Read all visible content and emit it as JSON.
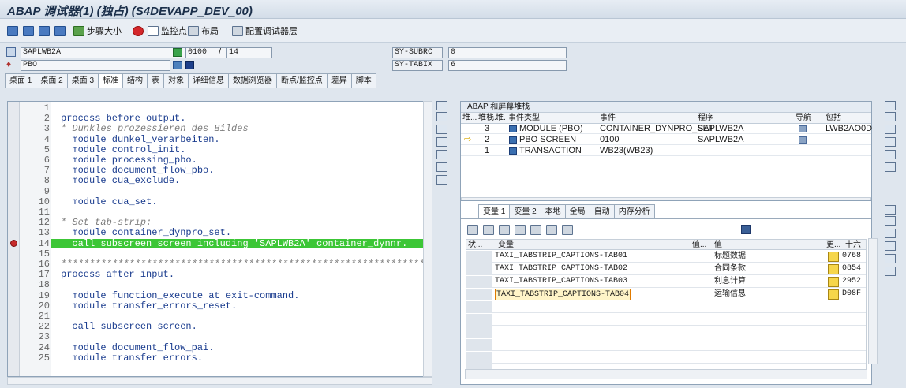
{
  "window": {
    "title": "ABAP 调试器(1)  (独占) (S4DEVAPP_DEV_00)"
  },
  "toolbar": {
    "step_size": "步骤大小",
    "watchpoint": "监控点",
    "layout": "布局",
    "configure": "配置调试器层"
  },
  "info": {
    "program": "SAPLWB2A",
    "screen_prog": "PBO",
    "dynpro": "0100",
    "dynpro_count": "14",
    "subrc_label": "SY-SUBRC",
    "subrc_value": "0",
    "tabix_label": "SY-TABIX",
    "tabix_value": "6"
  },
  "tabs": [
    "桌面 1",
    "桌面 2",
    "桌面 3",
    "标准",
    "结构",
    "表",
    "对象",
    "详细信息",
    "数据浏览器",
    "断点/监控点",
    "差异",
    "脚本"
  ],
  "active_tab": "标准",
  "code": {
    "lines": [
      {
        "n": "1",
        "t": ""
      },
      {
        "n": "2",
        "t": "process before output."
      },
      {
        "n": "3",
        "t": "* Dunkles prozessieren des Bildes"
      },
      {
        "n": "4",
        "t": "  module dunkel_verarbeiten."
      },
      {
        "n": "5",
        "t": "  module control_init."
      },
      {
        "n": "6",
        "t": "  module processing_pbo."
      },
      {
        "n": "7",
        "t": "  module document_flow_pbo."
      },
      {
        "n": "8",
        "t": "  module cua_exclude."
      },
      {
        "n": "9",
        "t": ""
      },
      {
        "n": "10",
        "t": "  module cua_set."
      },
      {
        "n": "11",
        "t": ""
      },
      {
        "n": "12",
        "t": "* Set tab-strip:"
      },
      {
        "n": "13",
        "t": "  module container_dynpro_set."
      },
      {
        "n": "14",
        "t": "  call subscreen screen including 'SAPLWB2A' container_dynnr."
      },
      {
        "n": "15",
        "t": ""
      },
      {
        "n": "16",
        "t": "************************************************************************"
      },
      {
        "n": "17",
        "t": "process after input."
      },
      {
        "n": "18",
        "t": ""
      },
      {
        "n": "19",
        "t": "  module function_execute at exit-command."
      },
      {
        "n": "20",
        "t": "  module transfer_errors_reset."
      },
      {
        "n": "21",
        "t": ""
      },
      {
        "n": "22",
        "t": "  call subscreen screen."
      },
      {
        "n": "23",
        "t": ""
      },
      {
        "n": "24",
        "t": "  module document_flow_pai."
      },
      {
        "n": "25",
        "t": "  module transfer errors."
      }
    ]
  },
  "stack": {
    "title": "ABAP 和屏幕堆栈",
    "headers": [
      "堆...",
      "堆栈...",
      "堆.",
      "事件类型",
      "事件",
      "程序",
      "导航",
      "包括"
    ],
    "rows": [
      {
        "depth": "3",
        "type": "MODULE (PBO)",
        "event": "CONTAINER_DYNPRO_SET",
        "program": "SAPLWB2A",
        "include": "LWB2AO0D"
      },
      {
        "depth": "2",
        "type": "PBO SCREEN",
        "event": "0100",
        "program": "SAPLWB2A",
        "include": ""
      },
      {
        "depth": "1",
        "type": "TRANSACTION",
        "event": "WB23(WB23)",
        "program": "",
        "include": ""
      }
    ]
  },
  "vars": {
    "tabs": [
      "变量 1",
      "变量 2",
      "本地",
      "全局",
      "自动",
      "内存分析"
    ],
    "headers": [
      "状...",
      "变量",
      "值...",
      "值",
      "更...",
      "十六"
    ],
    "rows": [
      {
        "var": "TAXI_TABSTRIP_CAPTIONS-TAB01",
        "val": "标题数据",
        "hex": "0768"
      },
      {
        "var": "TAXI_TABSTRIP_CAPTIONS-TAB02",
        "val": "合同条款",
        "hex": "0854"
      },
      {
        "var": "TAXI_TABSTRIP_CAPTIONS-TAB03",
        "val": "利息计算",
        "hex": "2952"
      },
      {
        "var": "TAXI_TABSTRIP_CAPTIONS-TAB04",
        "val": "运输信息",
        "hex": "D08F"
      }
    ]
  }
}
